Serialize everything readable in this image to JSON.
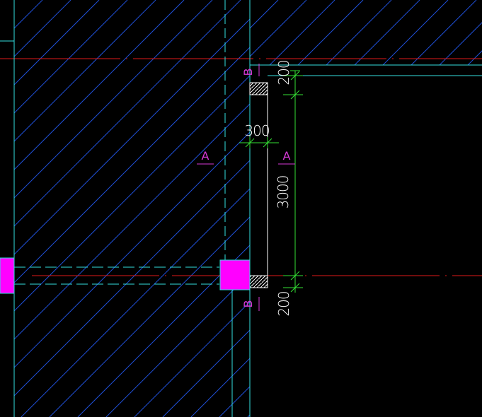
{
  "drawing": {
    "colors": {
      "background": "#000000",
      "hatch": "#1f4fd6",
      "wall_line": "#33e0e0",
      "axis_line": "#e01a1a",
      "dim_line": "#35e035",
      "dim_text": "#ffffff",
      "section_mark": "#d63ad6",
      "column_fill": "#ff00ff",
      "opening_outline": "#ffffff"
    },
    "dimensions": {
      "top_offset": "200",
      "width": "300",
      "height": "3000",
      "bottom_offset": "200"
    },
    "section_labels": {
      "a_left": "A",
      "a_right": "A",
      "b_top": "B",
      "b_bottom": "B"
    }
  }
}
